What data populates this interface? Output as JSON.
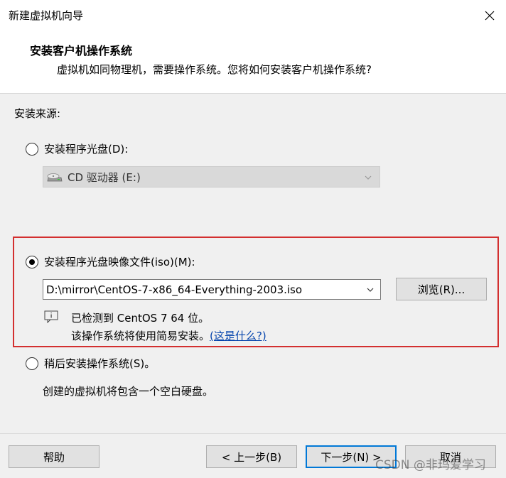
{
  "window": {
    "title": "新建虚拟机向导"
  },
  "header": {
    "title": "安装客户机操作系统",
    "subtitle": "虚拟机如同物理机，需要操作系统。您将如何安装客户机操作系统?"
  },
  "source": {
    "label": "安装来源:",
    "disc_option": {
      "label": "安装程序光盘(D):",
      "selected": false
    },
    "drive_select": {
      "value": "CD 驱动器 (E:)",
      "disabled": true
    },
    "iso_option": {
      "label": "安装程序光盘映像文件(iso)(M):",
      "selected": true
    },
    "iso_path": "D:\\mirror\\CentOS-7-x86_64-Everything-2003.iso",
    "browse_button": "浏览(R)...",
    "detected": "已检测到 CentOS 7 64 位。",
    "easy_install": "该操作系统将使用简易安装。",
    "what_link": "(这是什么?)",
    "later_option": {
      "label": "稍后安装操作系统(S)。",
      "selected": false
    },
    "later_desc": "创建的虚拟机将包含一个空白硬盘。"
  },
  "footer": {
    "help": "帮助",
    "back": "< 上一步(B)",
    "next": "下一步(N) >",
    "cancel": "取消"
  },
  "watermark": "CSDN @非玛爱学习",
  "colors": {
    "highlight": "#d32f2f",
    "link": "#0645ad",
    "accent": "#0078d7"
  }
}
